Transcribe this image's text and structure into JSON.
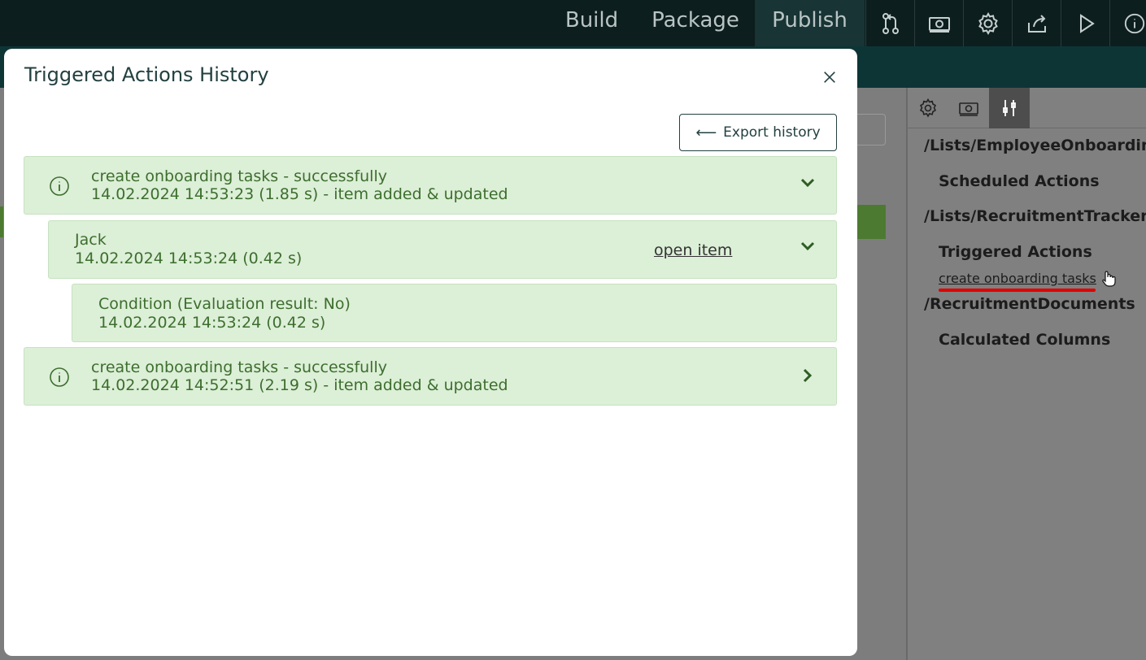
{
  "nav": {
    "build": "Build",
    "package": "Package",
    "publish": "Publish"
  },
  "toolbar_icons": [
    "branch-icon",
    "money-icon",
    "gear-icon",
    "share-icon",
    "play-icon",
    "info-icon"
  ],
  "right_panel": {
    "tab_icons": [
      "gear-icon",
      "money-icon",
      "tools-icon"
    ],
    "sections": [
      {
        "path": "/Lists/EmployeeOnboarding",
        "group": "Scheduled Actions"
      },
      {
        "path": "/Lists/RecruitmentTracker",
        "group": "Triggered Actions",
        "link": "create onboarding tasks"
      },
      {
        "path": "/RecruitmentDocuments",
        "group": "Calculated Columns"
      }
    ],
    "highlight_color": "#e00000"
  },
  "modal": {
    "title": "Triggered Actions History",
    "export_label": "Export history",
    "entries": [
      {
        "title": "create onboarding tasks - successfully",
        "detail": "14.02.2024 14:53:23 (1.85 s) - item added & updated",
        "expanded": true,
        "children": [
          {
            "title": "Jack",
            "detail": "14.02.2024 14:53:24 (0.42 s)",
            "link": "open item",
            "expanded": true,
            "children": [
              {
                "title": "Condition (Evaluation result: No)",
                "detail": "14.02.2024 14:53:24 (0.42 s)"
              }
            ]
          }
        ]
      },
      {
        "title": "create onboarding tasks - successfully",
        "detail": "14.02.2024 14:52:51 (2.19 s) - item added & updated",
        "expanded": false
      }
    ]
  },
  "colors": {
    "success_bg": "#dcefd7",
    "success_text": "#3d6e2e",
    "topbar": "#0d1e1e"
  }
}
